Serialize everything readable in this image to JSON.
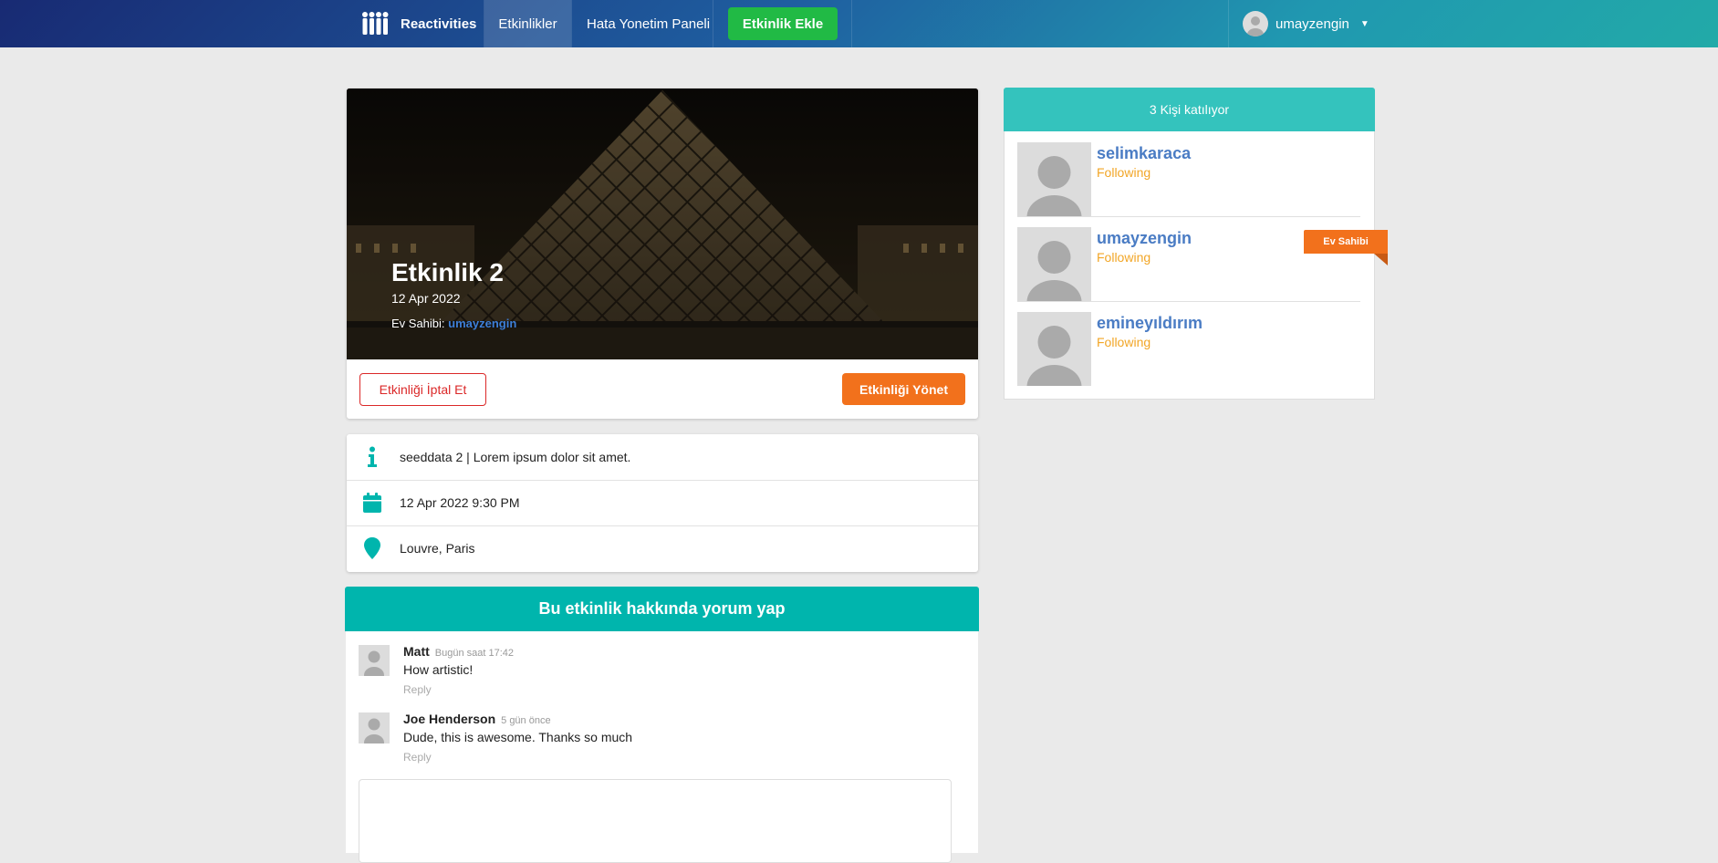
{
  "nav": {
    "brand": "Reactivities",
    "events": "Etkinlikler",
    "errors": "Hata Yonetim Paneli",
    "add_event": "Etkinlik Ekle",
    "username": "umayzengin"
  },
  "event": {
    "title": "Etkinlik 2",
    "date": "12 Apr 2022",
    "host_label": "Ev Sahibi:",
    "host_name": "umayzengin",
    "cancel_label": "Etkinliği İptal Et",
    "manage_label": "Etkinliği Yönet"
  },
  "info": {
    "description": "seeddata 2 | Lorem ipsum dolor sit amet.",
    "datetime": "12 Apr 2022 9:30 PM",
    "location": "Louvre, Paris"
  },
  "comments": {
    "header": "Bu etkinlik hakkında yorum yap",
    "items": [
      {
        "author": "Matt",
        "meta": "Bugün saat 17:42",
        "text": "How artistic!",
        "reply": "Reply"
      },
      {
        "author": "Joe Henderson",
        "meta": "5 gün önce",
        "text": "Dude, this is awesome. Thanks so much",
        "reply": "Reply"
      }
    ]
  },
  "attendees": {
    "header": "3 Kişi katılıyor",
    "host_badge": "Ev Sahibi",
    "items": [
      {
        "name": "selimkaraca",
        "status": "Following"
      },
      {
        "name": "umayzengin",
        "status": "Following"
      },
      {
        "name": "emineyıldırım",
        "status": "Following"
      }
    ]
  },
  "colors": {
    "teal": "#00b5ad",
    "orange": "#f2711c",
    "green": "#21ba45",
    "red": "#db2828"
  }
}
